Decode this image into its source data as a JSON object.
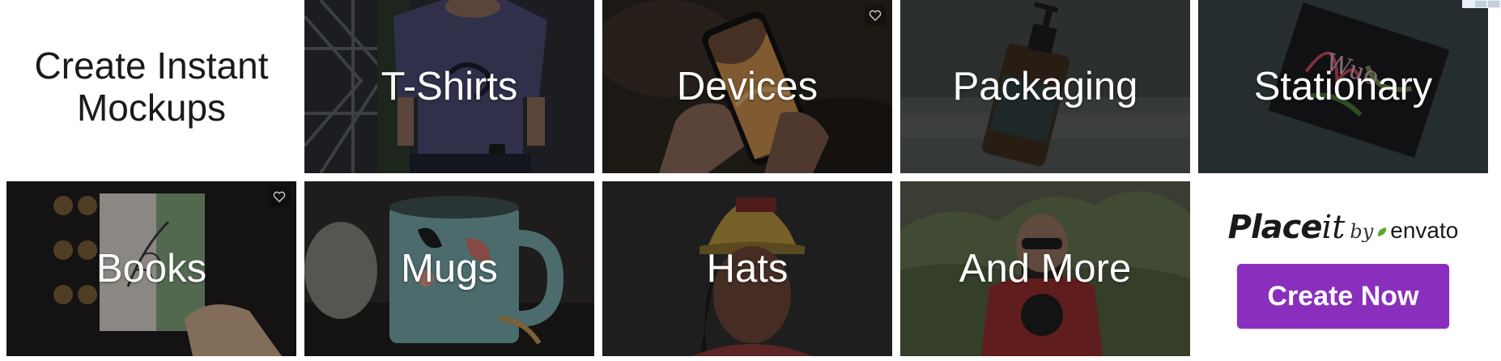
{
  "ad": {
    "headline": "Create Instant Mockups",
    "tiles": [
      {
        "label": "T-Shirts",
        "icon": "tshirt-photo"
      },
      {
        "label": "Devices",
        "icon": "phone-photo"
      },
      {
        "label": "Packaging",
        "icon": "bottle-photo"
      },
      {
        "label": "Stationary",
        "icon": "card-photo"
      },
      {
        "label": "Books",
        "icon": "book-photo"
      },
      {
        "label": "Mugs",
        "icon": "mug-photo"
      },
      {
        "label": "Hats",
        "icon": "cap-photo"
      },
      {
        "label": "And More",
        "icon": "hoodie-photo"
      }
    ],
    "brand": {
      "logo_place": "Place",
      "logo_it": "it",
      "logo_by": "by",
      "logo_envato": "envato"
    },
    "cta_label": "Create Now",
    "colors": {
      "cta_background": "#8a2fbd",
      "envato_leaf": "#5aa52e",
      "tile_overlay": "#000000"
    }
  }
}
